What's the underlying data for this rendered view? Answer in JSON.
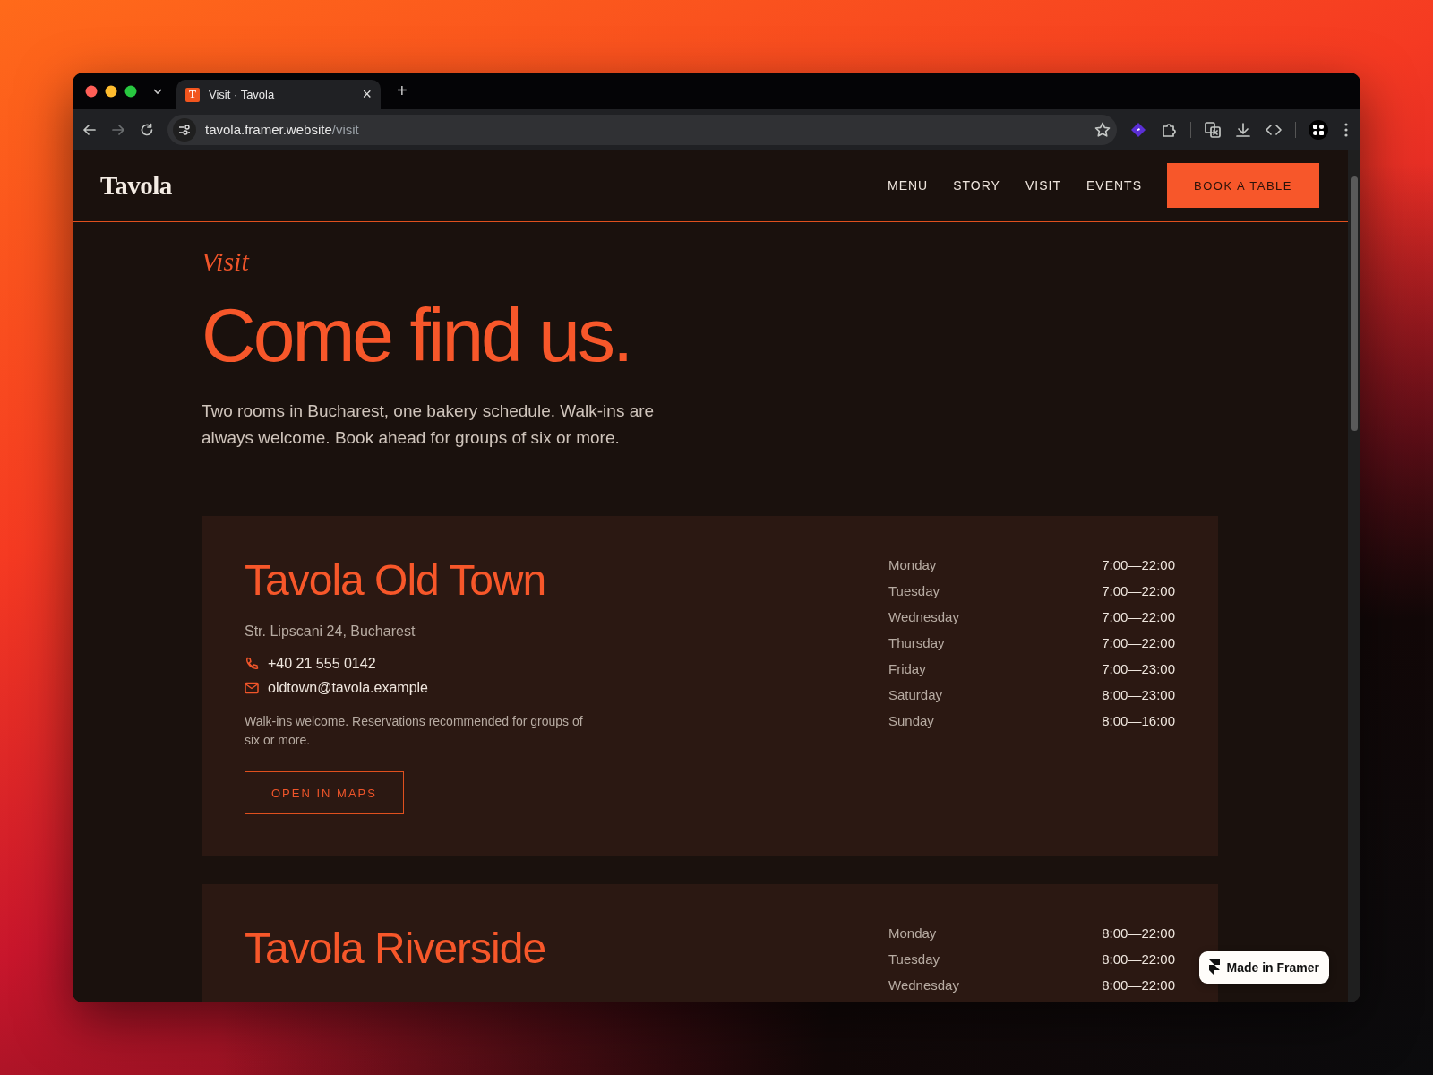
{
  "browser": {
    "tab": {
      "favicon": "T",
      "title": "Visit · Tavola",
      "close": "×"
    },
    "new_tab": "+",
    "url": {
      "host": "tavola.framer.website",
      "path": "/visit"
    }
  },
  "site": {
    "logo": "Tavola",
    "nav": [
      "MENU",
      "STORY",
      "VISIT",
      "EVENTS"
    ],
    "cta": "BOOK A TABLE"
  },
  "hero": {
    "eyebrow": "Visit",
    "title": "Come find us.",
    "intro": "Two rooms in Bucharest, one bakery schedule. Walk-ins are always welcome. Book ahead for groups of six or more."
  },
  "locations": [
    {
      "name": "Tavola Old Town",
      "address": "Str. Lipscani 24, Bucharest",
      "phone": "+40 21 555 0142",
      "email": "oldtown@tavola.example",
      "note": "Walk-ins welcome. Reservations recommended for groups of six or more.",
      "button": "OPEN IN MAPS",
      "hours": [
        {
          "day": "Monday",
          "time": "7:00—22:00"
        },
        {
          "day": "Tuesday",
          "time": "7:00—22:00"
        },
        {
          "day": "Wednesday",
          "time": "7:00—22:00"
        },
        {
          "day": "Thursday",
          "time": "7:00—22:00"
        },
        {
          "day": "Friday",
          "time": "7:00—23:00"
        },
        {
          "day": "Saturday",
          "time": "8:00—23:00"
        },
        {
          "day": "Sunday",
          "time": "8:00—16:00"
        }
      ]
    },
    {
      "name": "Tavola Riverside",
      "hours": [
        {
          "day": "Monday",
          "time": "8:00—22:00"
        },
        {
          "day": "Tuesday",
          "time": "8:00—22:00"
        },
        {
          "day": "Wednesday",
          "time": "8:00—22:00"
        }
      ]
    }
  ],
  "badge": "Made in Framer"
}
